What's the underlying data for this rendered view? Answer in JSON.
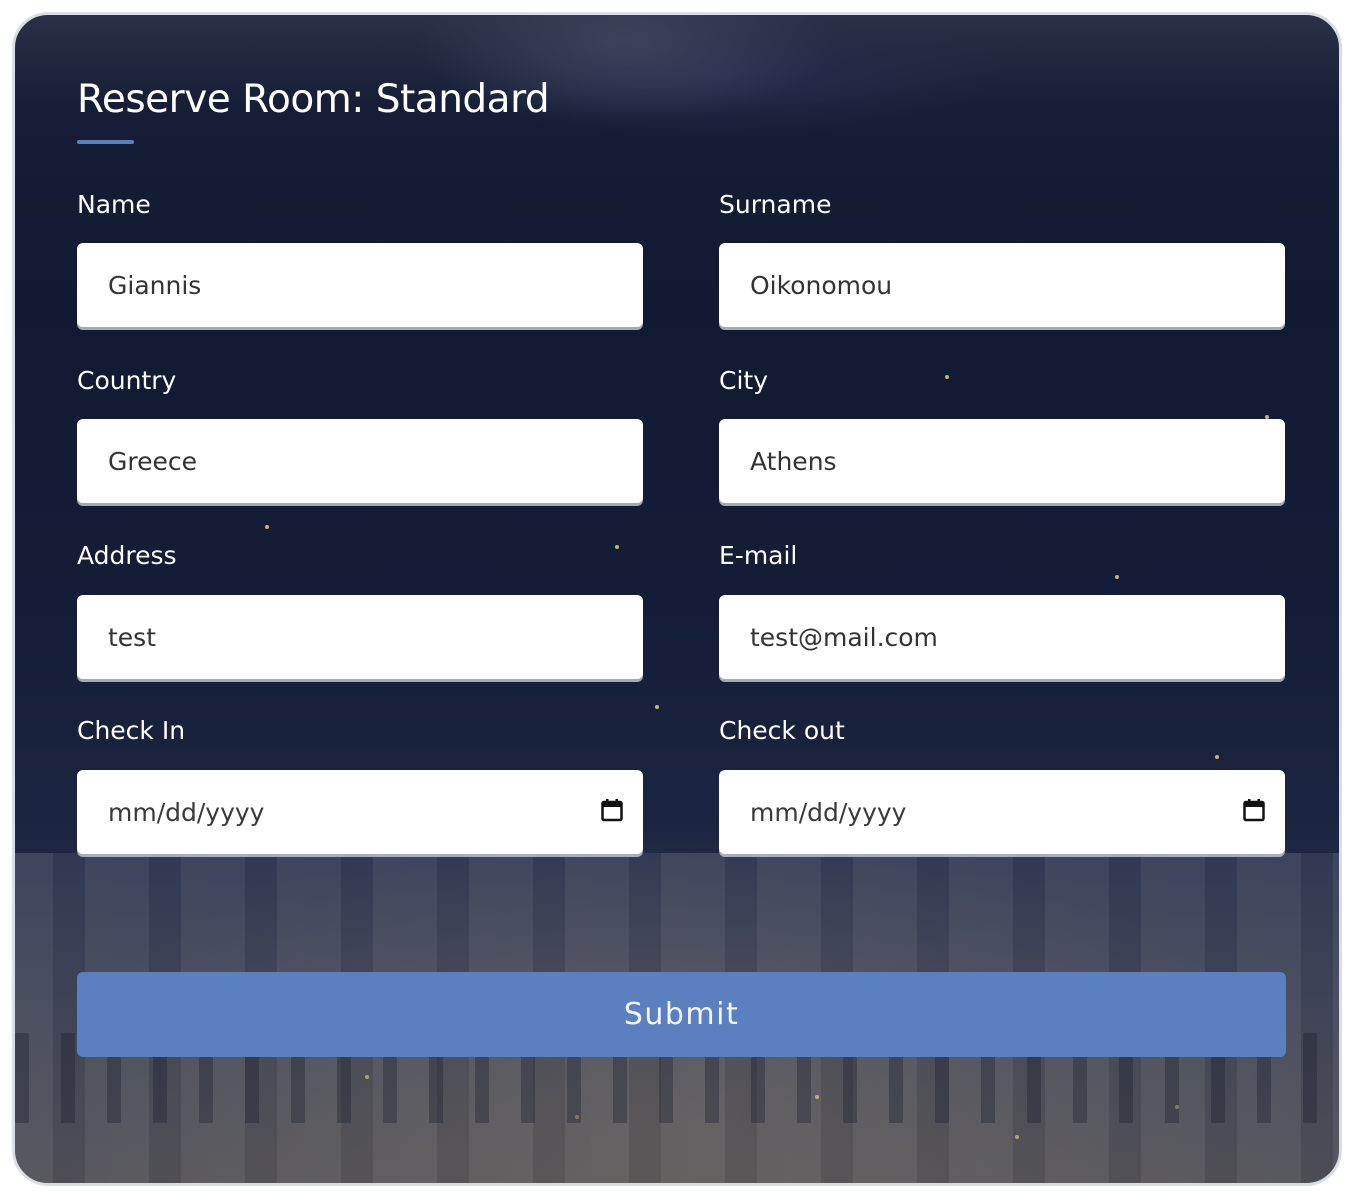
{
  "form": {
    "title": "Reserve Room: Standard",
    "fields": {
      "name": {
        "label": "Name",
        "value": "Giannis"
      },
      "surname": {
        "label": "Surname",
        "value": "Oikonomou"
      },
      "country": {
        "label": "Country",
        "value": "Greece"
      },
      "city": {
        "label": "City",
        "value": "Athens"
      },
      "address": {
        "label": "Address",
        "value": "test"
      },
      "email": {
        "label": "E-mail",
        "value": "test@mail.com"
      },
      "check_in": {
        "label": "Check In",
        "placeholder": "mm/dd/yyyy"
      },
      "check_out": {
        "label": "Check out",
        "placeholder": "mm/dd/yyyy"
      }
    },
    "submit_label": "Submit"
  },
  "icons": {
    "date_picker": "calendar-icon"
  },
  "colors": {
    "accent": "#5b80bf",
    "text_on_dark": "#ffffff",
    "input_bg": "#ffffff"
  }
}
